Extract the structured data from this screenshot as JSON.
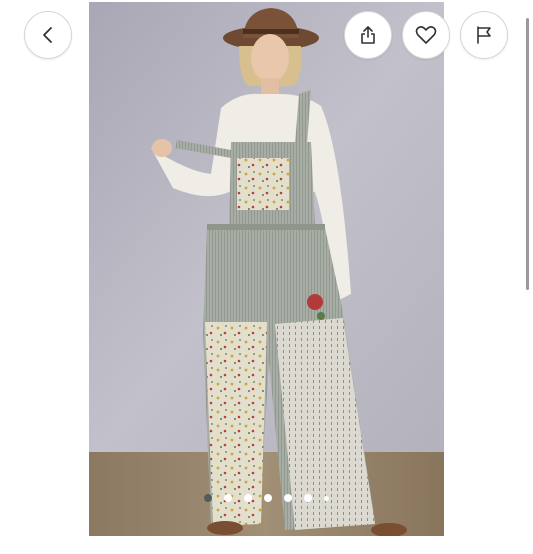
{
  "listing": {
    "image_count": 8,
    "current_image": 1
  },
  "icons": {
    "back": "chevron-left-icon",
    "share": "share-icon",
    "like": "heart-outline-icon",
    "report": "flag-icon"
  },
  "colors": {
    "button_border": "#d6d6d6",
    "dot_active": "#555a5e",
    "dot_inactive": "#ffffff"
  }
}
